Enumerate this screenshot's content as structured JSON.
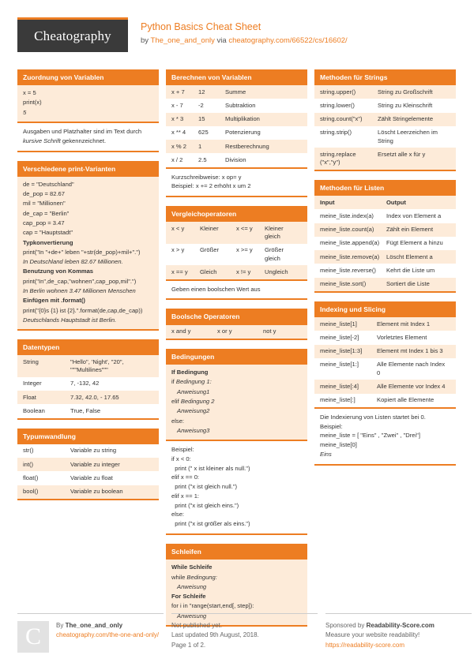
{
  "header": {
    "logo": "Cheatography",
    "title": "Python Basics Cheat Sheet",
    "by_prefix": "by ",
    "author": "The_one_and_only",
    "via": " via ",
    "url": "cheatography.com/66522/cs/16602/"
  },
  "col1": {
    "zuordnung": {
      "title": "Zuordnung von Variablen",
      "lines": [
        "x = 5",
        "print(x)",
        "5"
      ],
      "italic_index": 2,
      "note": [
        "Ausgaben und Platzhalter sind im Text durch",
        "kursive Schrift gekennzeichnet."
      ],
      "note_italic_word": "kursive Schrift"
    },
    "print_varianten": {
      "title": "Verschiedene print-Varianten",
      "lines": [
        {
          "text": "de = \"Deutschland\"",
          "style": "normal"
        },
        {
          "text": "de_pop = 82.67",
          "style": "normal"
        },
        {
          "text": "mil = \"Millionen\"",
          "style": "normal"
        },
        {
          "text": "de_cap = \"Berlin\"",
          "style": "normal"
        },
        {
          "text": "cap_pop = 3.47",
          "style": "normal"
        },
        {
          "text": "cap = \"Hauptstadt\"",
          "style": "normal"
        },
        {
          "text": "Typkonvertierung",
          "style": "bold"
        },
        {
          "text": "print(\"In \"+de+\" leben \"+str(de_pop)+mil+\".\")",
          "style": "normal"
        },
        {
          "text": "In Deutschland leben 82.67 Millionen.",
          "style": "italic"
        },
        {
          "text": "Benutzung von Kommas",
          "style": "bold"
        },
        {
          "text": "print(\"In\",de_cap,\"wohnen\",cap_pop,mil\".\")",
          "style": "normal"
        },
        {
          "text": "In Berlin wohnen 3.47 Millionen Menschen",
          "style": "italic"
        },
        {
          "text": "Einfügen mit .format()",
          "style": "bold"
        },
        {
          "text": "print(\"{0}s {1} ist {2}.\".format(de,cap,de_cap))",
          "style": "normal"
        },
        {
          "text": "Deutschlands Hauptstadt ist Berlin.",
          "style": "italic"
        }
      ]
    },
    "datentypen": {
      "title": "Datentypen",
      "rows": [
        [
          "String",
          "\"Hello\", 'Night', \"20\", \"\"\"Multilines\"\"\""
        ],
        [
          "Integer",
          "7, -132, 42"
        ],
        [
          "Float",
          "7.32, 42.0, - 17.65"
        ],
        [
          "Boolean",
          "True, False"
        ]
      ]
    },
    "typumwandlung": {
      "title": "Typumwandlung",
      "rows": [
        [
          "str()",
          "Variable zu string"
        ],
        [
          "int()",
          "Variable zu integer"
        ],
        [
          "float()",
          "Variable zu float"
        ],
        [
          "bool()",
          "Variable zu boolean"
        ]
      ]
    }
  },
  "col2": {
    "berechnen": {
      "title": "Berechnen von Variablen",
      "rows": [
        [
          "x + 7",
          "12",
          "Summe"
        ],
        [
          "x - 7",
          "-2",
          "Subtraktion"
        ],
        [
          "x * 3",
          "15",
          "Multiplikation"
        ],
        [
          "x ** 4",
          "625",
          "Potenzierung"
        ],
        [
          "x % 2",
          "1",
          "Restberechnung"
        ],
        [
          "x / 2",
          "2.5",
          "Division"
        ]
      ],
      "note": [
        "Kurzschreibweise: x op= y",
        "Beispiel: x += 2 erhöht x um 2"
      ]
    },
    "vergleich": {
      "title": "Vergleichoperatoren",
      "rows": [
        [
          "x < y",
          "Kleiner",
          "x <= y",
          "Kleiner gleich"
        ],
        [
          "x > y",
          "Größer",
          "x >= y",
          "Größer gleich"
        ],
        [
          "x == y",
          "Gleich",
          "x != y",
          "Ungleich"
        ]
      ],
      "note": [
        "Geben einen boolschen Wert aus"
      ]
    },
    "boolsche": {
      "title": "Boolsche Operatoren",
      "rows": [
        [
          "x and y",
          "x or y",
          "not y"
        ]
      ]
    },
    "bedingungen": {
      "title": "Bedingungen",
      "lines": [
        {
          "text": "If Bedingung",
          "style": "bold"
        },
        {
          "text": "if Bedingung 1:",
          "style": "italic-part",
          "plain": "if ",
          "ital": "Bedingung 1:"
        },
        {
          "text": "Anweisung1",
          "style": "italic-indent"
        },
        {
          "text": "elif Bedingung 2",
          "style": "italic-part",
          "plain": "elif ",
          "ital": "Bedingung 2"
        },
        {
          "text": "Anweisung2",
          "style": "italic-indent"
        },
        {
          "text": "else:",
          "style": "normal"
        },
        {
          "text": "Anweisung3",
          "style": "italic-indent"
        }
      ],
      "note": [
        "Beispiel:",
        "if x < 0:",
        "  print (\" x ist kleiner als null.\")",
        "elif x == 0:",
        "  print (\"x ist gleich null.\")",
        "elif x == 1:",
        "  print (\"x ist gleich eins.\")",
        "else:",
        "  print (\"x ist größer als eins.\")"
      ]
    },
    "schleifen": {
      "title": "Schleifen",
      "lines": [
        {
          "text": "While Schleife",
          "style": "bold"
        },
        {
          "text": "while Bedingung:",
          "style": "italic-part",
          "plain": "while ",
          "ital": "Bedingung:"
        },
        {
          "text": "Anweisung",
          "style": "italic-indent"
        },
        {
          "text": "For Schleife",
          "style": "bold"
        },
        {
          "text": "for i in \"range(start,end[, step]):",
          "style": "normal"
        },
        {
          "text": "Anweisung",
          "style": "italic-indent"
        }
      ]
    }
  },
  "col3": {
    "strings": {
      "title": "Methoden für Strings",
      "rows": [
        [
          "string.upper()",
          "String zu Großschrift"
        ],
        [
          "string.lower()",
          "String zu Kleinschrift"
        ],
        [
          "string.count(\"x\")",
          "Zählt Stringelemente"
        ],
        [
          "string.strip()",
          "Löscht Leerzeichen im String"
        ],
        [
          "string.replace (\"x\",\"y\")",
          "Ersetzt alle x für y"
        ]
      ]
    },
    "listen": {
      "title": "Methoden für Listen",
      "header": [
        "Input",
        "Output"
      ],
      "rows": [
        [
          "meine_liste.index(a)",
          "Index von Element a"
        ],
        [
          "meine_liste.count(a)",
          "Zählt ein Element"
        ],
        [
          "meine_liste.append(a)",
          "Fügt Element a hinzu"
        ],
        [
          "meine_liste.remove(a)",
          "Löscht Element a"
        ],
        [
          "meine_liste.reverse()",
          "Kehrt die Liste um"
        ],
        [
          "meine_liste.sort()",
          "Sortiert die Liste"
        ]
      ]
    },
    "indexing": {
      "title": "Indexing und Slicing",
      "rows": [
        [
          "meine_liste[1]",
          "Element mit Index 1"
        ],
        [
          "meine_liste[-2]",
          "Vorletztes Element"
        ],
        [
          "meine_liste[1:3]",
          "Element mt Index 1 bis 3"
        ],
        [
          "meine_liste[1:]",
          "Alle Elemente nach Index 0"
        ],
        [
          "meine_liste[:4]",
          "Alle Elemente vor Index 4"
        ],
        [
          "meine_liste[:]",
          "Kopiert alle Elemente"
        ]
      ],
      "note": [
        "Die Indexierung von Listen startet bei 0.",
        "Beispiel:",
        "meine_liste = [ \"Eins\" , \"Zwei\" , \"Drei\"]",
        "meine_liste[0]",
        "Eins"
      ],
      "note_italic_index": 4
    }
  },
  "footer": {
    "badge_letter": "C",
    "by_label": "By ",
    "author": "The_one_and_only",
    "author_url": "cheatography.com/the-one-and-only/",
    "publish_status": "Not published yet.",
    "last_updated": "Last updated 9th August, 2018.",
    "page_info": "Page 1 of 2.",
    "sponsor_prefix": "Sponsored by ",
    "sponsor_name": "Readability-Score.com",
    "sponsor_tagline": "Measure your website readability!",
    "sponsor_url": "https://readability-score.com"
  }
}
